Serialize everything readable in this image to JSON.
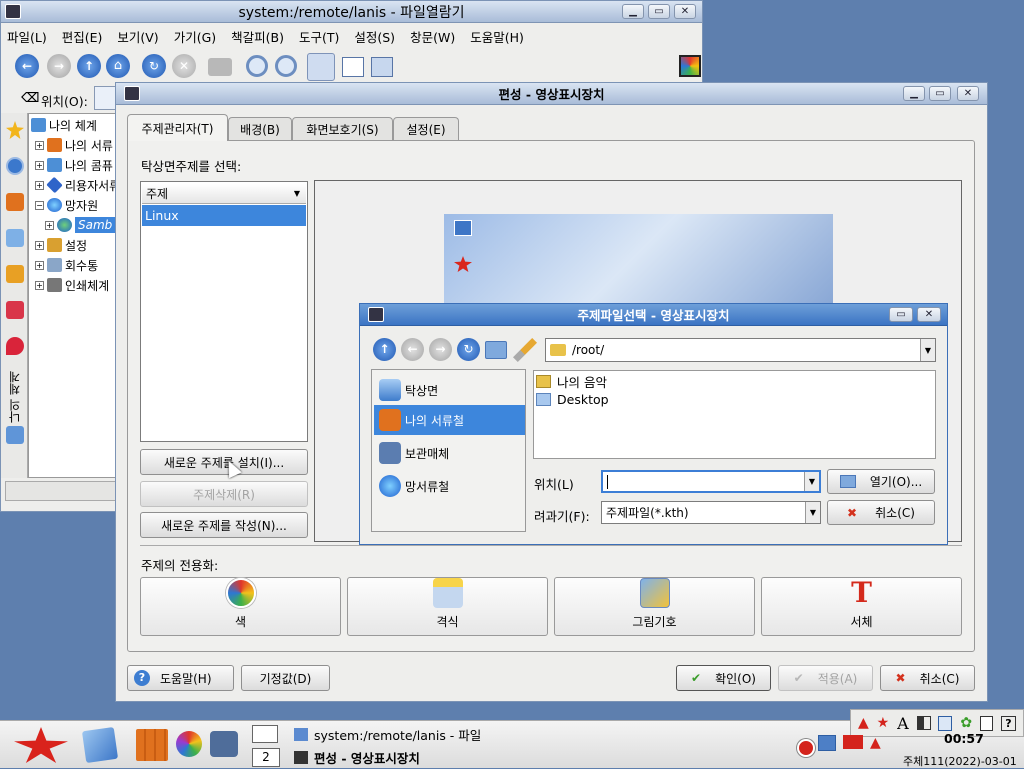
{
  "file_manager": {
    "title": "system:/remote/lanis - 파일열람기",
    "menu": [
      "파일(L)",
      "편집(E)",
      "보기(V)",
      "가기(G)",
      "책갈피(B)",
      "도구(T)",
      "설정(S)",
      "창문(W)",
      "도움말(H)"
    ],
    "location_label": "위치(O):",
    "tree": [
      {
        "label": "나의 체계",
        "depth": 0,
        "expander": "",
        "icon": "computer",
        "color": "#4d8fd6"
      },
      {
        "label": "나의 서류",
        "depth": 1,
        "expander": "+",
        "icon": "documents",
        "color": "#e0711e"
      },
      {
        "label": "나의 콤퓨",
        "depth": 1,
        "expander": "+",
        "icon": "computer",
        "color": "#4d8fd6"
      },
      {
        "label": "리용자서류",
        "depth": 1,
        "expander": "+",
        "icon": "book",
        "color": "#2f64c9"
      },
      {
        "label": "망자원",
        "depth": 1,
        "expander": "−",
        "icon": "globe",
        "color": "#2b7ae0"
      },
      {
        "label": "Samb",
        "depth": 2,
        "expander": "+",
        "icon": "samba",
        "color": "#2b7ae0",
        "selected": true
      },
      {
        "label": "설정",
        "depth": 1,
        "expander": "+",
        "icon": "settings",
        "color": "#d9a030"
      },
      {
        "label": "회수통",
        "depth": 1,
        "expander": "+",
        "icon": "trash",
        "color": "#8aa6c8"
      },
      {
        "label": "인쇄체계",
        "depth": 1,
        "expander": "+",
        "icon": "printer",
        "color": "#777"
      }
    ],
    "side_tab_label": "나의 체계",
    "side_icons": [
      "star-icon",
      "history-icon",
      "documents-icon",
      "network-icon",
      "settings-icon",
      "bookmark-icon",
      "pin-icon"
    ]
  },
  "display_dialog": {
    "title": "편성 - 영상표시장치",
    "tabs": [
      "주제관리자(T)",
      "배경(B)",
      "화면보호기(S)",
      "설정(E)"
    ],
    "select_label": "탁상면주제를 선택:",
    "theme_column": "주제",
    "themes": [
      "Linux"
    ],
    "buttons": {
      "install": "새로운 주제를 설치(I)...",
      "remove": "주제삭제(R)",
      "create": "새로운 주제를 작성(N)..."
    },
    "customize_label": "주제의 전용화:",
    "customize_items": [
      {
        "label": "색",
        "icon": "color-icon",
        "color": "#e07b2a"
      },
      {
        "label": "격식",
        "icon": "style-icon",
        "color": "#e8b82a"
      },
      {
        "label": "그림기호",
        "icon": "icons-icon",
        "color": "#3d8ad6"
      },
      {
        "label": "서체",
        "icon": "font-icon",
        "color": "#d42a1c"
      }
    ],
    "footer": {
      "help": "도움말(H)",
      "defaults": "기정값(D)",
      "ok": "확인(O)",
      "apply": "적용(A)",
      "cancel": "취소(C)"
    }
  },
  "file_dialog": {
    "title": "주제파일선택 - 영상표시장치",
    "path": "/root/",
    "places": [
      {
        "label": "탁상면",
        "color": "#4a8ed6"
      },
      {
        "label": "나의 서류철",
        "color": "#e0711e",
        "selected": true
      },
      {
        "label": "보관매체",
        "color": "#5b7db0"
      },
      {
        "label": "망서류철",
        "color": "#2b7ae0"
      }
    ],
    "files": [
      "나의 음악",
      "Desktop"
    ],
    "location_label": "위치(L)",
    "location_value": "",
    "filter_label": "려과기(F):",
    "filter_value": "주제파일(*.kth)",
    "open_label": "열기(O)...",
    "cancel_label": "취소(C)"
  },
  "taskbar": {
    "desktop_number": "2",
    "tasks": [
      "system:/remote/lanis - 파일",
      "편성 - 영상표시장치"
    ],
    "clock": "00:57",
    "date": "주체111(2022)-03-01"
  },
  "colors": {
    "accent": "#3c7ed6",
    "selection": "#3d86dc",
    "titlebar": "#b9cbe3"
  }
}
